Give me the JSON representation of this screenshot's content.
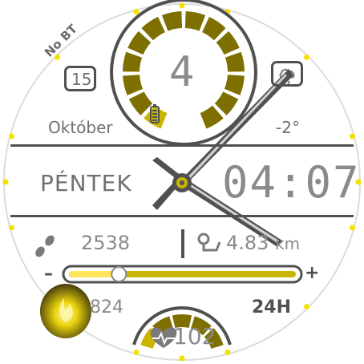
{
  "colors": {
    "accent": "#c9b400",
    "accent_light": "#ffe45c",
    "accent_dark": "#7e7000",
    "dark": "#505050",
    "text": "#8a8a8a",
    "bezel_dot": "#f5e100"
  },
  "status": {
    "bluetooth": "No BT",
    "battery_icon": "battery-icon"
  },
  "date": {
    "day": "15",
    "month": "Október",
    "weekday": "PÉNTEK"
  },
  "weather": {
    "temperature": "-2°",
    "icon": "weather-icon"
  },
  "steps_ring": {
    "value": "4",
    "level_fraction": 0.1
  },
  "time": {
    "display": "04:07",
    "format": "24H"
  },
  "activity": {
    "steps": "2538",
    "distance": "4.83",
    "distance_unit": "km"
  },
  "slider": {
    "minus": "–",
    "plus": "+",
    "level_fraction": 0.22
  },
  "calories": {
    "value": "824"
  },
  "heart": {
    "bpm": "102",
    "level_fraction": 0.9
  }
}
